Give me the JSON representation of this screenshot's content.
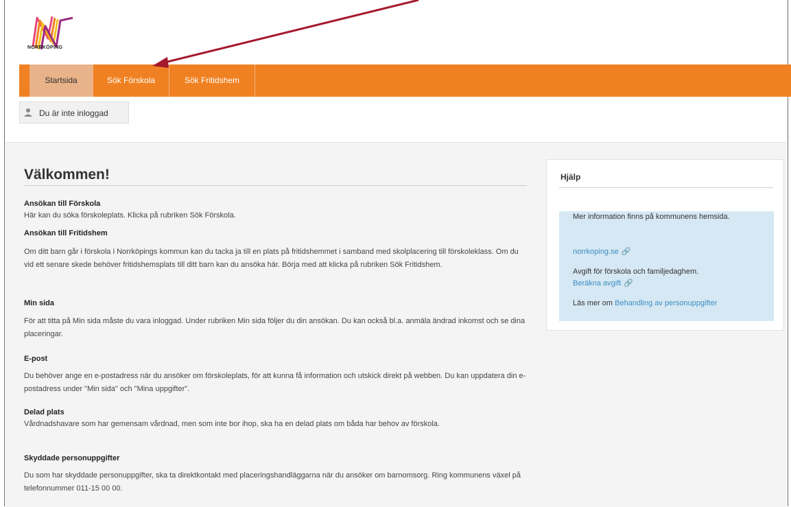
{
  "brand": {
    "name": "NORRKÖPING"
  },
  "nav": {
    "items": [
      {
        "label": "Startsida",
        "active": true
      },
      {
        "label": "Sök Förskola",
        "active": false
      },
      {
        "label": "Sök Fritidshem",
        "active": false
      }
    ]
  },
  "login": {
    "status": "Du är inte inloggad"
  },
  "main": {
    "title": "Välkommen!",
    "sections": [
      {
        "heading": "Ansökan till Förskola",
        "text": "Här kan du söka förskoleplats. Klicka på rubriken Sök Förskola."
      },
      {
        "heading": "Ansökan till Fritidshem",
        "text": "Om ditt barn går i förskola i Norrköpings kommun kan du tacka ja till en plats på fritidshemmet i samband med skolplacering till förskoleklass. Om du vid ett senare skede behöver fritidshemsplats till ditt barn kan du ansöka här. Börja med att klicka på rubriken Sök Fritidshem."
      },
      {
        "heading": "Min sida",
        "text": "För att titta på Min sida måste du vara inloggad. Under rubriken Min sida följer du din ansökan. Du kan också bl.a. anmäla ändrad inkomst och se dina placeringar."
      },
      {
        "heading": "E-post",
        "text": "Du behöver ange en e-postadress när du ansöker om förskoleplats, för att kunna få information och utskick direkt på webben. Du kan uppdatera din e-postadress under \"Min sida\" och \"Mina uppgifter\"."
      },
      {
        "heading": "Delad plats",
        "text": "Vårdnadshavare som har gemensam vårdnad, men som inte bor ihop, ska ha en delad plats om båda har behov av förskola."
      },
      {
        "heading": "Skyddade personuppgifter",
        "text": "Du som har skyddade personuppgifter, ska ta direktkontakt med placeringshandläggarna när du ansöker om barnomsorg. Ring kommunens växel på telefonnummer 011-15 00 00."
      }
    ]
  },
  "help": {
    "title": "Hjälp",
    "info_text": "Mer information finns på kommunens hemsida.",
    "site_link": "norrkoping.se",
    "fee_text": "Avgift för förskola och familjedaghem.",
    "fee_link": "Beräkna avgift",
    "gdpr_prefix": "Läs mer om",
    "gdpr_link": "Behandling av personuppgifter"
  },
  "colors": {
    "nav_bg": "#f08122",
    "nav_active": "#e9b38a",
    "info_bg": "#d6e8f3",
    "link": "#3a8ec2",
    "arrow": "#a5192c"
  },
  "icons": [
    "user-icon",
    "paperclip-icon",
    "annotation-arrow"
  ]
}
